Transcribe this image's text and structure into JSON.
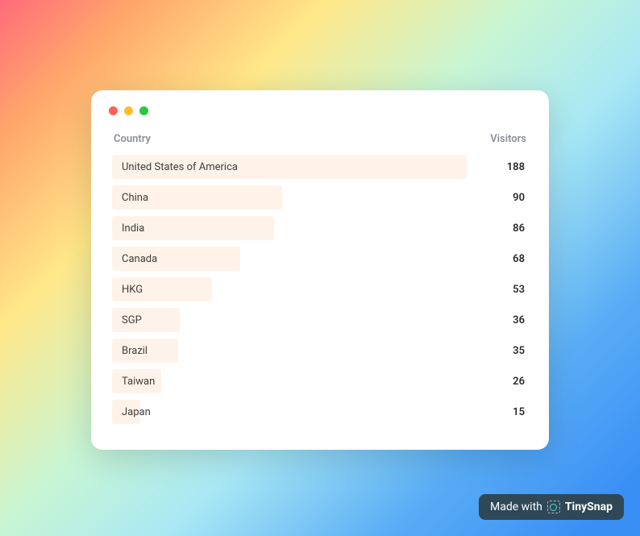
{
  "headers": {
    "country": "Country",
    "visitors": "Visitors"
  },
  "chart_data": {
    "type": "bar",
    "title": "",
    "xlabel": "Visitors",
    "ylabel": "Country",
    "categories": [
      "United States of America",
      "China",
      "India",
      "Canada",
      "HKG",
      "SGP",
      "Brazil",
      "Taiwan",
      "Japan"
    ],
    "values": [
      188,
      90,
      86,
      68,
      53,
      36,
      35,
      26,
      15
    ]
  },
  "watermark": {
    "prefix": "Made with",
    "brand": "TinySnap"
  },
  "colors": {
    "bar_fill": "#fff3e9",
    "text_primary": "#3d3d3d",
    "text_header": "#8a8f98",
    "watermark_bg": "#2f4858"
  }
}
